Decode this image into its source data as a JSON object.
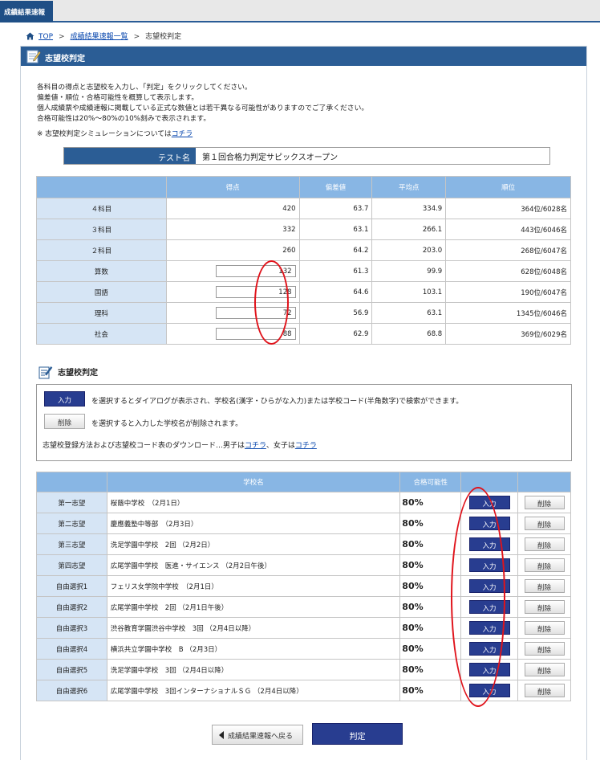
{
  "header": {
    "tab_label": "成績結果速報"
  },
  "breadcrumb": {
    "home": "TOP",
    "sep1": ">",
    "list": "成績結果速報一覧",
    "sep2": ">",
    "current": "志望校判定"
  },
  "page_title": "志望校判定",
  "intro": {
    "lines": [
      "各科目の得点と志望校を入力し、「判定」をクリックしてください。",
      "偏差値・順位・合格可能性を概算して表示します。",
      "個人成績票や成績速報に掲載している正式な数値とは若干異なる可能性がありますのでご了承ください。",
      "合格可能性は20%〜80%の10%刻みで表示されます。"
    ],
    "note_prefix": "※ 志望校判定シミュレーションについては",
    "note_link": "コチラ"
  },
  "test": {
    "label": "テスト名",
    "value": "第１回合格力判定サピックスオープン"
  },
  "score_table": {
    "headers": [
      "",
      "得点",
      "偏差値",
      "平均点",
      "順位"
    ],
    "rows": [
      {
        "label": "４科目",
        "score": "420",
        "dev": "63.7",
        "avg": "334.9",
        "rank": "364位/6028名",
        "editable": false
      },
      {
        "label": "３科目",
        "score": "332",
        "dev": "63.1",
        "avg": "266.1",
        "rank": "443位/6046名",
        "editable": false
      },
      {
        "label": "２科目",
        "score": "260",
        "dev": "64.2",
        "avg": "203.0",
        "rank": "268位/6047名",
        "editable": false
      },
      {
        "label": "算数",
        "score": "132",
        "dev": "61.3",
        "avg": "99.9",
        "rank": "628位/6048名",
        "editable": true
      },
      {
        "label": "国語",
        "score": "128",
        "dev": "64.6",
        "avg": "103.1",
        "rank": "190位/6047名",
        "editable": true
      },
      {
        "label": "理科",
        "score": "72",
        "dev": "56.9",
        "avg": "63.1",
        "rank": "1345位/6046名",
        "editable": true
      },
      {
        "label": "社会",
        "score": "88",
        "dev": "62.9",
        "avg": "68.8",
        "rank": "369位/6029名",
        "editable": true
      }
    ]
  },
  "judge_section": {
    "title": "志望校判定",
    "input_btn": "入力",
    "input_desc": "を選択するとダイアログが表示され、学校名(漢字・ひらがな入力)または学校コード(半角数字)で検索ができます。",
    "delete_btn": "削除",
    "delete_desc": "を選択すると入力した学校名が削除されます。",
    "download_prefix": "志望校登録方法および志望校コード表のダウンロード…男子は",
    "download_boys": "コチラ",
    "download_mid": "、女子は",
    "download_girls": "コチラ"
  },
  "school_table": {
    "headers": [
      "",
      "学校名",
      "合格可能性",
      "",
      ""
    ],
    "input_label": "入力",
    "delete_label": "削除",
    "rows": [
      {
        "label": "第一志望",
        "school": "桜蔭中学校　（2月1日）",
        "prob": "80%"
      },
      {
        "label": "第二志望",
        "school": "慶應義塾中等部　（2月3日）",
        "prob": "80%"
      },
      {
        "label": "第三志望",
        "school": "洗足学園中学校　2回 （2月2日）",
        "prob": "80%"
      },
      {
        "label": "第四志望",
        "school": "広尾学園中学校　医進・サイエンス （2月2日午後）",
        "prob": "80%"
      },
      {
        "label": "自由選択1",
        "school": "フェリス女学院中学校　（2月1日）",
        "prob": "80%"
      },
      {
        "label": "自由選択2",
        "school": "広尾学園中学校　2回 （2月1日午後）",
        "prob": "80%"
      },
      {
        "label": "自由選択3",
        "school": "渋谷教育学園渋谷中学校　3回 （2月4日以降）",
        "prob": "80%"
      },
      {
        "label": "自由選択4",
        "school": "横浜共立学園中学校　B （2月3日）",
        "prob": "80%"
      },
      {
        "label": "自由選択5",
        "school": "洗足学園中学校　3回 （2月4日以降）",
        "prob": "80%"
      },
      {
        "label": "自由選択6",
        "school": "広尾学園中学校　3回インターナショナルＳＧ （2月4日以降）",
        "prob": "80%"
      }
    ]
  },
  "footer": {
    "back_label": "成績結果速報へ戻る",
    "judge_label": "判定"
  },
  "colors": {
    "brand": "#2b5d95",
    "header_cell": "#88b6e4",
    "row_label": "#d6e5f5",
    "button_blue": "#283d90",
    "annotation": "#e0131b"
  }
}
